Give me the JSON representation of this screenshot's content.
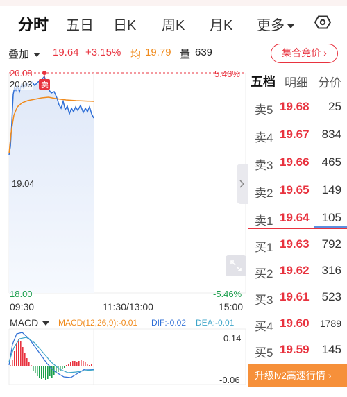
{
  "tabs": [
    {
      "label": "分时",
      "active": true
    },
    {
      "label": "五日"
    },
    {
      "label": "日K"
    },
    {
      "label": "周K"
    },
    {
      "label": "月K"
    },
    {
      "label": "更多"
    }
  ],
  "info": {
    "overlay_label": "叠加",
    "price": "19.64",
    "change_pct": "+3.15%",
    "avg_label": "均",
    "avg_value": "19.79",
    "volume_label": "量",
    "volume_value": "639",
    "auction_button": "集合竞价"
  },
  "chart": {
    "price_high": "20.08",
    "price_high2": "20.03",
    "price_mid": "19.04",
    "price_low": "18.00",
    "pct_high": "5.46%",
    "pct_low": "-5.46%",
    "sell_marker": "卖",
    "time_start": "09:30",
    "time_mid": "11:30/13:00",
    "time_end": "15:00",
    "macd_label": "MACD",
    "macd_params": "MACD(12,26,9):-0.01",
    "dif": "DIF:-0.02",
    "dea": "DEA:-0.01",
    "macd_high": "0.14",
    "macd_low": "-0.06",
    "colors": {
      "price_line": "#2f6fd6",
      "avg_line": "#f08b1d",
      "up": "#e8333f",
      "down": "#1a9f4c"
    }
  },
  "book": {
    "tabs": [
      {
        "label": "五档",
        "active": true
      },
      {
        "label": "明细"
      },
      {
        "label": "分价"
      }
    ],
    "asks": [
      {
        "label": "卖5",
        "price": "19.68",
        "volume": "25"
      },
      {
        "label": "卖4",
        "price": "19.67",
        "volume": "834"
      },
      {
        "label": "卖3",
        "price": "19.66",
        "volume": "465"
      },
      {
        "label": "卖2",
        "price": "19.65",
        "volume": "149"
      },
      {
        "label": "卖1",
        "price": "19.64",
        "volume": "105"
      }
    ],
    "bids": [
      {
        "label": "买1",
        "price": "19.63",
        "volume": "792"
      },
      {
        "label": "买2",
        "price": "19.62",
        "volume": "316"
      },
      {
        "label": "买3",
        "price": "19.61",
        "volume": "523"
      },
      {
        "label": "买4",
        "price": "19.60",
        "volume": "1789"
      },
      {
        "label": "买5",
        "price": "19.59",
        "volume": "145"
      }
    ],
    "upgrade": "升级lv2高速行情"
  }
}
